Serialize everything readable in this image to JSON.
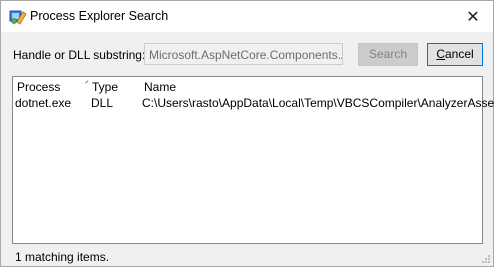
{
  "window": {
    "title": "Process Explorer Search",
    "app_icon": "process-explorer-icon",
    "close_glyph": "✕"
  },
  "search": {
    "label": "Handle or DLL substring:",
    "value": "Microsoft.AspNetCore.Components.Analy",
    "search_button": "Search",
    "cancel_button_prefix": "",
    "cancel_button_accel": "C",
    "cancel_button_rest": "ancel"
  },
  "results": {
    "columns": [
      "Process",
      "Type",
      "Name"
    ],
    "rows": [
      {
        "process": "dotnet.exe",
        "type": "DLL",
        "name": "C:\\Users\\rasto\\AppData\\Local\\Temp\\VBCSCompiler\\AnalyzerAssem..."
      }
    ]
  },
  "status": {
    "text": "1 matching items."
  }
}
